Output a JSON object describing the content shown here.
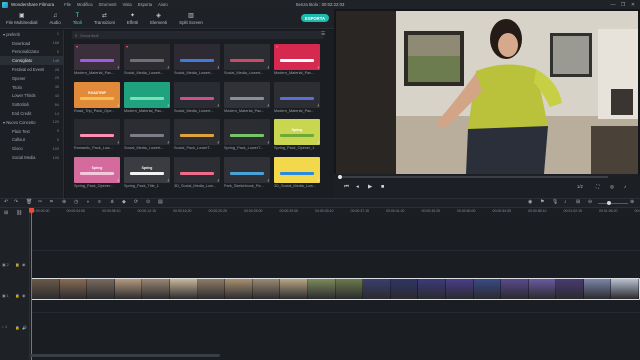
{
  "window": {
    "app_title": "Wondershare Filmora",
    "project_title": "Senza titolo : 00:02:22:03",
    "menu": [
      "File",
      "Modifica",
      "Strumenti",
      "Vista",
      "Esporta",
      "Aiuto"
    ],
    "controls": [
      "—",
      "❐",
      "✕"
    ]
  },
  "toolbar": {
    "tabs": [
      {
        "label": "File Multimediali",
        "icon": "media-folder-icon",
        "glyph": "▣"
      },
      {
        "label": "Audio",
        "icon": "audio-note-icon",
        "glyph": "♫"
      },
      {
        "label": "Titoli",
        "icon": "titles-text-icon",
        "glyph": "T"
      },
      {
        "label": "Transizioni",
        "icon": "transitions-icon",
        "glyph": "⇄"
      },
      {
        "label": "Effetti",
        "icon": "effects-icon",
        "glyph": "✦"
      },
      {
        "label": "Elementi",
        "icon": "elements-icon",
        "glyph": "◈"
      },
      {
        "label": "Split Screen",
        "icon": "split-screen-icon",
        "glyph": "▥"
      }
    ],
    "active_tab": "Titoli",
    "export_label": "ESPORTA"
  },
  "sidebar": {
    "items": [
      {
        "label": "preferiti",
        "count": "1",
        "folder": true,
        "active": false
      },
      {
        "label": "Download",
        "count": "166",
        "folder": false,
        "active": false
      },
      {
        "label": "Personalizzato",
        "count": "0",
        "folder": false,
        "active": false
      },
      {
        "label": "Consigliato",
        "count": "148",
        "folder": false,
        "active": true
      },
      {
        "label": "Festival ed Eventi",
        "count": "28",
        "folder": false,
        "active": false
      },
      {
        "label": "Opener",
        "count": "25",
        "folder": false,
        "active": false
      },
      {
        "label": "Titolo",
        "count": "45",
        "folder": false,
        "active": false
      },
      {
        "label": "Lower Thirds",
        "count": "43",
        "folder": false,
        "active": false
      },
      {
        "label": "Sottotitoli",
        "count": "84",
        "folder": false,
        "active": false
      },
      {
        "label": "End Credit",
        "count": "14",
        "folder": false,
        "active": false
      },
      {
        "label": "Nuovo Concetto",
        "count": "120",
        "folder": true,
        "active": false
      },
      {
        "label": "Plain Text",
        "count": "9",
        "folder": false,
        "active": false
      },
      {
        "label": "Callout",
        "count": "9",
        "folder": false,
        "active": false
      },
      {
        "label": "Gioco",
        "count": "103",
        "folder": false,
        "active": false
      },
      {
        "label": "Social Media",
        "count": "100",
        "folder": false,
        "active": false
      }
    ]
  },
  "library": {
    "search_placeholder": "Cerca titoli",
    "cards": [
      {
        "label": "Modern_Material_Pac...",
        "thumb_text": "",
        "bg": "#3a2f3a",
        "accent": "#9b5de5",
        "fav": true
      },
      {
        "label": "Social_Media_Lowert...",
        "thumb_text": "",
        "bg": "#2b2b30",
        "accent": "#6f6f7a",
        "fav": true
      },
      {
        "label": "Social_Media_Lowert...",
        "thumb_text": "",
        "bg": "#2e2a33",
        "accent": "#3f7bd9",
        "fav": false
      },
      {
        "label": "Social_Media_Lowert...",
        "thumb_text": "",
        "bg": "#2c2d33",
        "accent": "#c84b6a",
        "fav": false
      },
      {
        "label": "Modern_Material_Pac...",
        "thumb_text": "",
        "bg": "#d6294f",
        "accent": "#ffffff",
        "fav": true
      },
      {
        "label": "Road_Trip_Pack_Ope...",
        "thumb_text": "ROADTRIP",
        "bg": "#e08a3a",
        "accent": "#f2c14e",
        "fav": false
      },
      {
        "label": "Modern_Material_Pac...",
        "thumb_text": "",
        "bg": "#1fa37e",
        "accent": "#7ee0b0",
        "fav": false
      },
      {
        "label": "Social_Media_Lowert...",
        "thumb_text": "",
        "bg": "#2a2c33",
        "accent": "#d04f8a",
        "fav": false
      },
      {
        "label": "Modern_Material_Pac...",
        "thumb_text": "",
        "bg": "#303238",
        "accent": "#8a8f99",
        "fav": false
      },
      {
        "label": "Modern_Material_Pac...",
        "thumb_text": "",
        "bg": "#2d2e34",
        "accent": "#5b6fd9",
        "fav": false
      },
      {
        "label": "Romantic_Pack_Low...",
        "thumb_text": "",
        "bg": "#2a2b31",
        "accent": "#ff8fb1",
        "fav": false
      },
      {
        "label": "Social_Media_Lowert...",
        "thumb_text": "",
        "bg": "#2b2d33",
        "accent": "#7c7f88",
        "fav": false
      },
      {
        "label": "Social_Pack_LowerT...",
        "thumb_text": "",
        "bg": "#2c2e34",
        "accent": "#e0a23a",
        "fav": false
      },
      {
        "label": "Spring_Pack_LowerT...",
        "thumb_text": "",
        "bg": "#2b2d33",
        "accent": "#78c46a",
        "fav": false
      },
      {
        "label": "Spring_Pack_Opener_1",
        "thumb_text": "Spring",
        "bg": "#c9d650",
        "accent": "#6ea836",
        "fav": false
      },
      {
        "label": "Spring_Pack_Opener...",
        "thumb_text": "Spring",
        "bg": "#d46b9c",
        "accent": "#f5c7dc",
        "fav": false
      },
      {
        "label": "Spring_Pack_Title_1",
        "thumb_text": "Spring",
        "bg": "#3a3c42",
        "accent": "#f2f2f2",
        "fav": false
      },
      {
        "label": "3D_Social_Media_Low...",
        "thumb_text": "",
        "bg": "#2c2e34",
        "accent": "#f06a8a",
        "fav": false
      },
      {
        "label": "Park_Sketchbook_Pa...",
        "thumb_text": "",
        "bg": "#2f3137",
        "accent": "#4aa3d8",
        "fav": false
      },
      {
        "label": "3D_Social_Media_Low...",
        "thumb_text": "",
        "bg": "#f2d84a",
        "accent": "#2b8ad9",
        "fav": false
      }
    ]
  },
  "player": {
    "progress": 0,
    "page_indicator": "1/2"
  },
  "timeline": {
    "ruler_ticks": [
      "00:00:00:00",
      "00:00:04:05",
      "00:00:08:10",
      "00:00:12:15",
      "00:00:16:20",
      "00:00:20:25",
      "00:00:25:00",
      "00:00:29:05",
      "00:00:33:10",
      "00:00:37:15",
      "00:00:41:20",
      "00:00:45:25",
      "00:00:50:00",
      "00:00:54:05",
      "00:00:58:10",
      "00:01:02:15",
      "00:01:06:20",
      "00:01:10:25"
    ],
    "clip_frames": [
      "#6b5a48",
      "#8a6c55",
      "#7a6a5e",
      "#b59a7c",
      "#9a8672",
      "#c9b79a",
      "#8f7d66",
      "#a8916f",
      "#9a8a73",
      "#b8a585",
      "#7e8a5a",
      "#6d7a4c",
      "#3a3f6e",
      "#2f3566",
      "#3c3a7a",
      "#4a3e8a",
      "#3a4a86",
      "#5a4a8e",
      "#6a5aa0",
      "#4a3a72",
      "#7a86a8",
      "#b8c0d0"
    ]
  }
}
